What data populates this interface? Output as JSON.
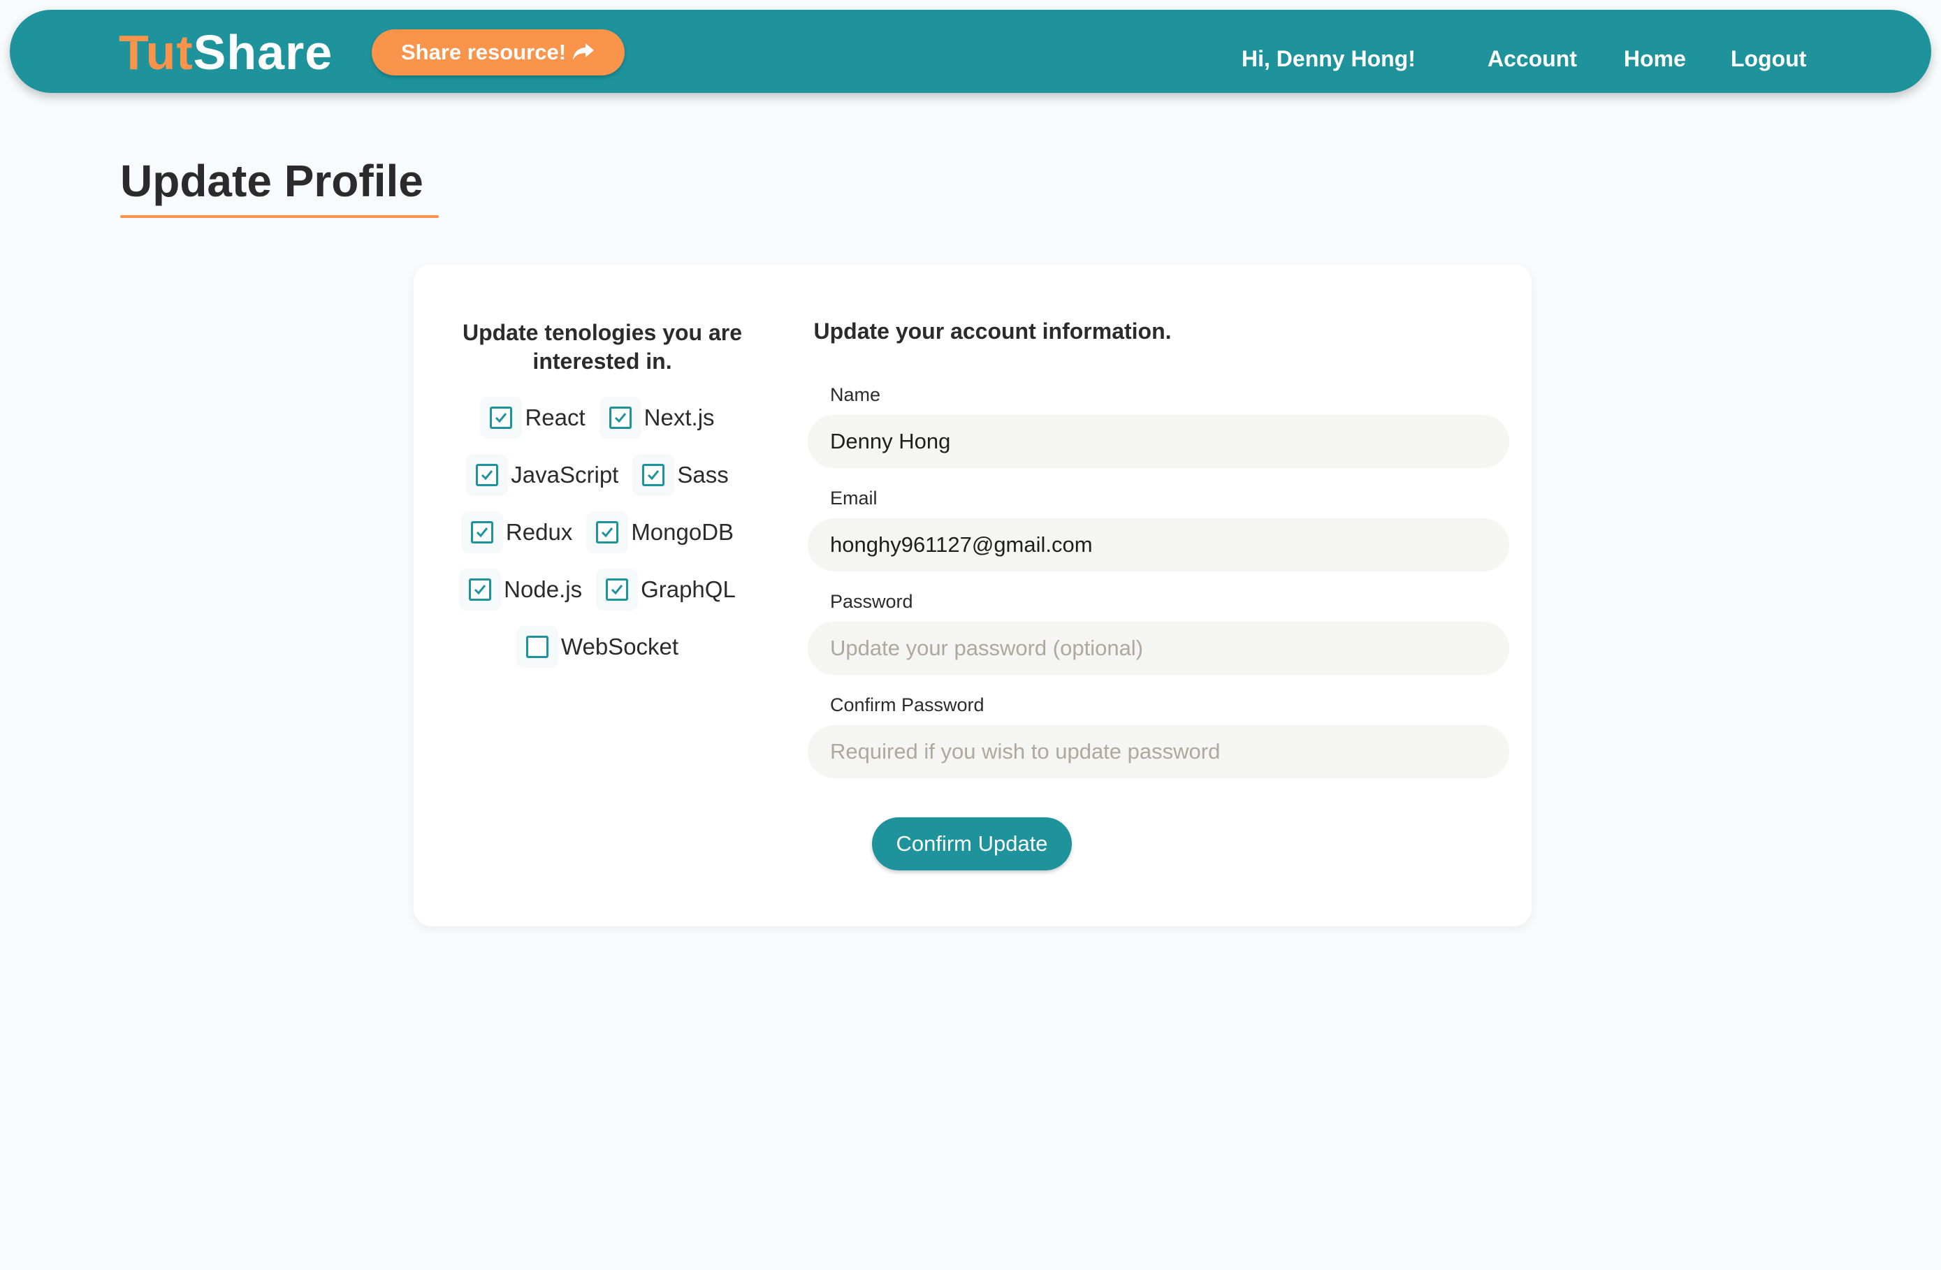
{
  "navbar": {
    "brand_part1": "Tut",
    "brand_part2": "Share",
    "share_label": "Share resource!",
    "share_icon": "share-arrow-icon",
    "greeting": "Hi, Denny Hong!",
    "links": {
      "account": "Account",
      "home": "Home",
      "logout": "Logout"
    }
  },
  "page": {
    "title": "Update Profile"
  },
  "technologies": {
    "heading": "Update tenologies you are interested in.",
    "rows": [
      [
        {
          "label": "React",
          "checked": true
        },
        {
          "label": "Next.js",
          "checked": true
        }
      ],
      [
        {
          "label": "JavaScript",
          "checked": true
        },
        {
          "label": "Sass",
          "checked": true
        }
      ],
      [
        {
          "label": "Redux",
          "checked": true
        },
        {
          "label": "MongoDB",
          "checked": true
        }
      ],
      [
        {
          "label": "Node.js",
          "checked": true
        },
        {
          "label": "GraphQL",
          "checked": true
        }
      ],
      [
        {
          "label": "WebSocket",
          "checked": false
        }
      ]
    ]
  },
  "account": {
    "heading": "Update your account information.",
    "name": {
      "label": "Name",
      "value": "Denny Hong"
    },
    "email": {
      "label": "Email",
      "value": "honghy961127@gmail.com"
    },
    "password": {
      "label": "Password",
      "placeholder": "Update your password (optional)"
    },
    "confirm_password": {
      "label": "Confirm Password",
      "placeholder": "Required if you wish to update password"
    },
    "submit_label": "Confirm Update"
  },
  "colors": {
    "primary": "#1e939c",
    "accent": "#f9944a",
    "background": "#f8fbfc"
  }
}
